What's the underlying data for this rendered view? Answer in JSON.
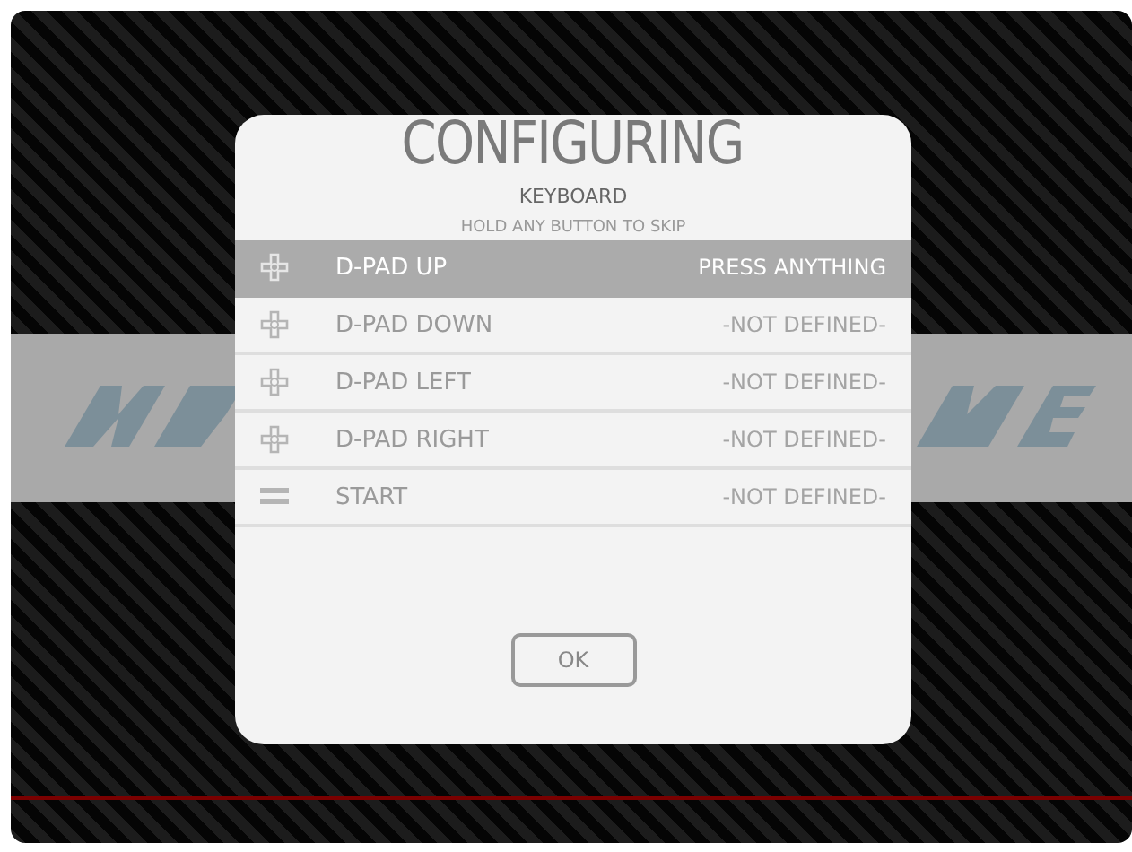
{
  "dialog": {
    "title": "CONFIGURING",
    "device": "KEYBOARD",
    "hint": "HOLD ANY BUTTON TO SKIP",
    "inputs": [
      {
        "kind": "dpad",
        "label": "D-PAD UP",
        "value": "PRESS ANYTHING",
        "selected": true
      },
      {
        "kind": "dpad",
        "label": "D-PAD DOWN",
        "value": "-NOT DEFINED-",
        "selected": false
      },
      {
        "kind": "dpad",
        "label": "D-PAD LEFT",
        "value": "-NOT DEFINED-",
        "selected": false
      },
      {
        "kind": "dpad",
        "label": "D-PAD RIGHT",
        "value": "-NOT DEFINED-",
        "selected": false
      },
      {
        "kind": "start",
        "label": "START",
        "value": "-NOT DEFINED-",
        "selected": false
      }
    ],
    "button": "OK"
  }
}
